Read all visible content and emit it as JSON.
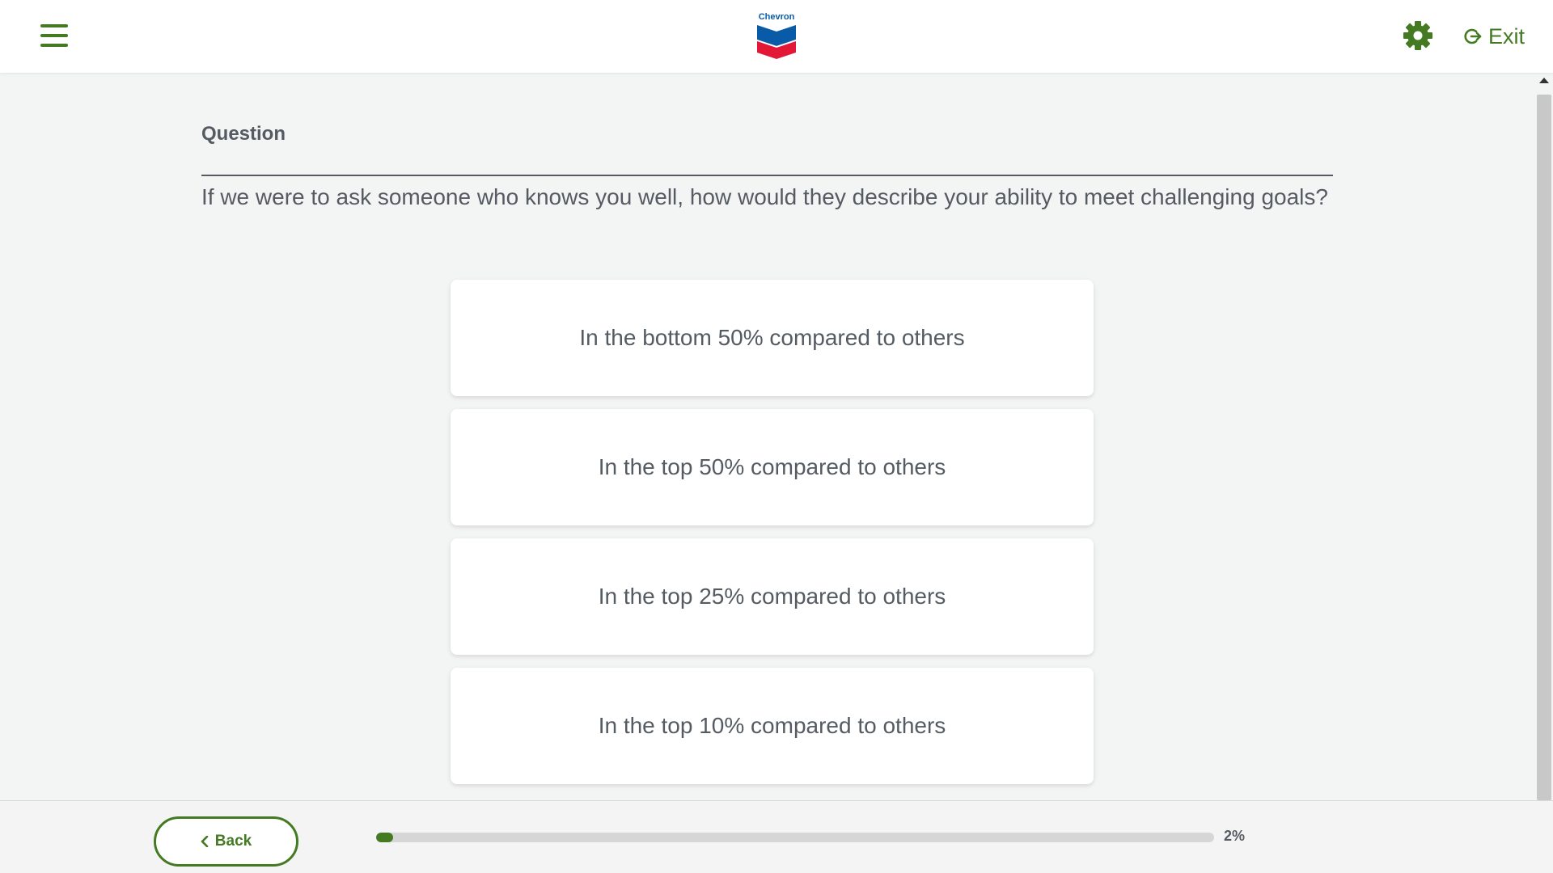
{
  "header": {
    "logo_text": "Chevron",
    "exit_label": "Exit",
    "icons": {
      "menu": "hamburger-menu-icon",
      "settings": "gear-icon",
      "exit": "exit-icon"
    }
  },
  "question": {
    "label": "Question",
    "text": "If we were to ask someone who knows you well, how would they describe your ability to meet challenging goals?"
  },
  "answers": [
    {
      "label": "In the bottom 50% compared to others"
    },
    {
      "label": "In the top 50% compared to others"
    },
    {
      "label": "In the top 25% compared to others"
    },
    {
      "label": "In the top 10% compared to others"
    }
  ],
  "footer": {
    "back_label": "Back",
    "progress_percent": 2,
    "progress_label": "2%"
  },
  "colors": {
    "accent": "#437a22",
    "text": "#555b62",
    "background": "#f3f4f4",
    "logo_blue": "#0a5ba7",
    "logo_red": "#e21836"
  }
}
